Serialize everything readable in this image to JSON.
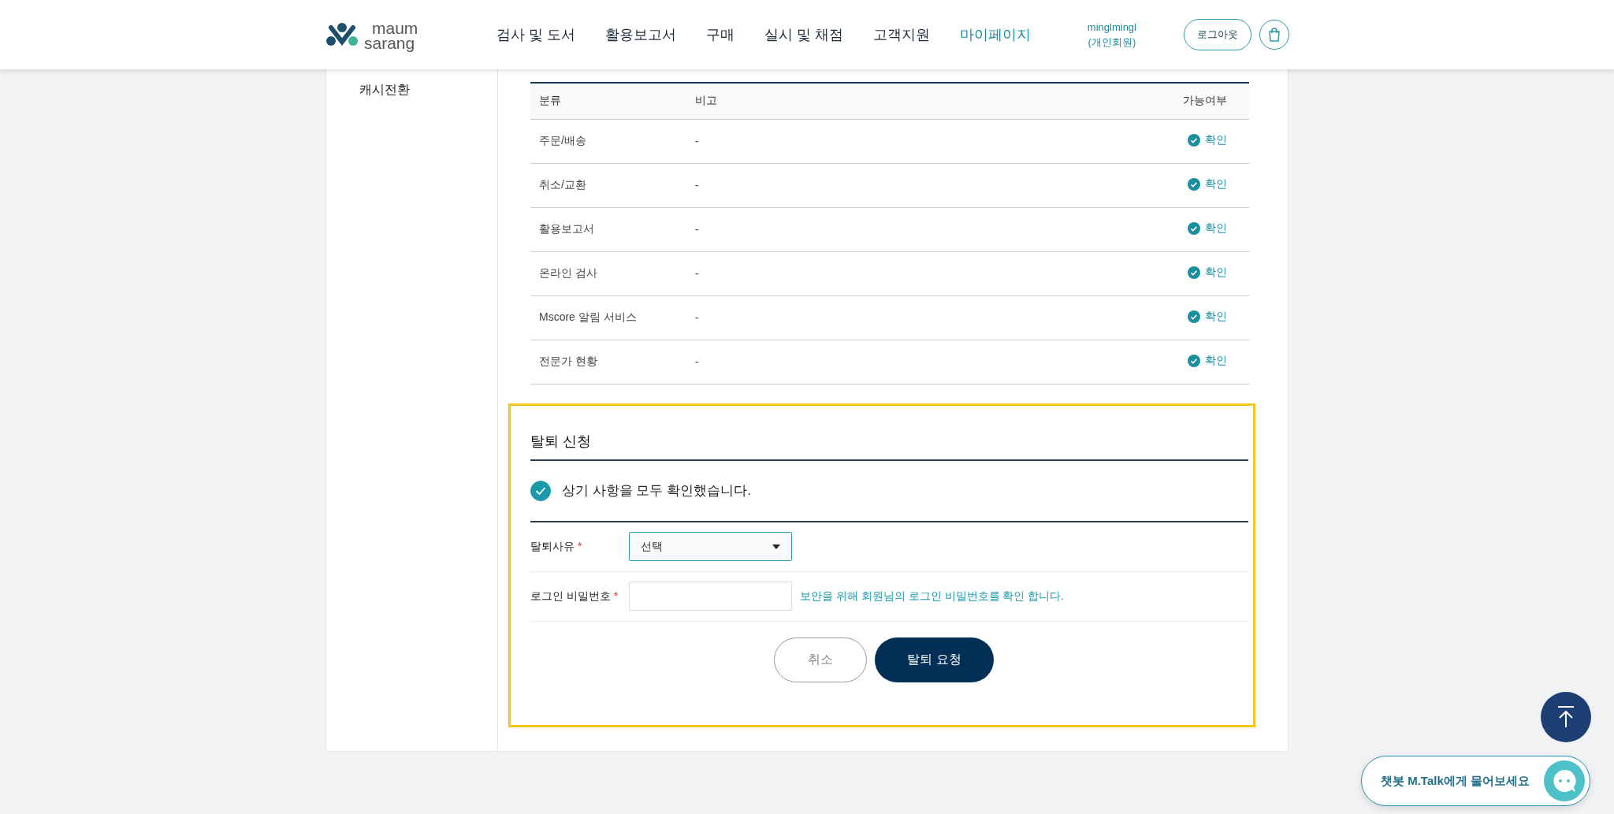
{
  "header": {
    "logo": [
      "maum",
      "sarang"
    ],
    "nav": [
      {
        "label": "검사 및 도서",
        "selected": false
      },
      {
        "label": "활용보고서",
        "selected": false
      },
      {
        "label": "구매",
        "selected": false
      },
      {
        "label": "실시 및 채점",
        "selected": false
      },
      {
        "label": "고객지원",
        "selected": false
      },
      {
        "label": "마이페이지",
        "selected": true
      }
    ],
    "user": [
      "minglmingl",
      "(개인회원)"
    ],
    "logout": "로그아웃"
  },
  "sidebar": {
    "items": [
      "캐시전환"
    ]
  },
  "table": {
    "columns": [
      "분류",
      "비고",
      "가능여부"
    ],
    "rows": [
      {
        "category": "주문/배송",
        "note": "-",
        "status": "확인"
      },
      {
        "category": "취소/교환",
        "note": "-",
        "status": "확인"
      },
      {
        "category": "활용보고서",
        "note": "-",
        "status": "확인"
      },
      {
        "category": "온라인 검사",
        "note": "-",
        "status": "확인"
      },
      {
        "category": "Mscore 알림 서비스",
        "note": "-",
        "status": "확인"
      },
      {
        "category": "전문가 현황",
        "note": "-",
        "status": "확인"
      }
    ]
  },
  "withdrawal": {
    "title": "탈퇴 신청",
    "confirm": {
      "label": "상기 사항을 모두 확인했습니다.",
      "checked": true
    },
    "reason": {
      "label": "탈퇴사유",
      "required": "*",
      "value": "선택"
    },
    "password": {
      "label": "로그인 비밀번호",
      "required": "*",
      "hint": "보안을 위해 회원님의 로그인 비밀번호를 확인 합니다."
    },
    "buttons": {
      "cancel": "취소",
      "submit": "탈퇴 요청"
    }
  },
  "chatbot": {
    "label": "챗봇 M.Talk에게 물어보세요"
  }
}
